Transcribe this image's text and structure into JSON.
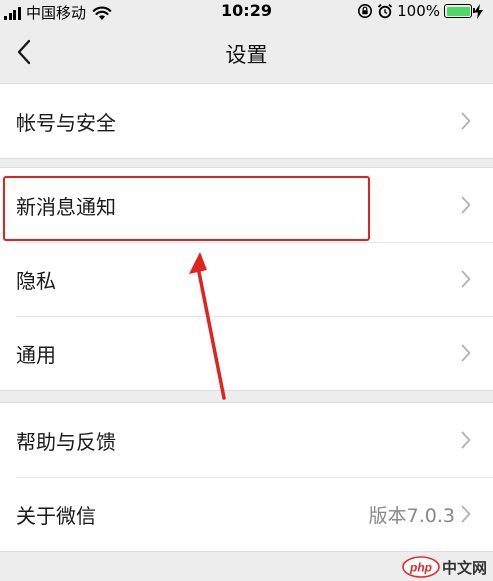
{
  "status_bar": {
    "carrier": "中国移动",
    "time": "10:29",
    "battery_percent": "100%",
    "battery_level": 1.0
  },
  "nav": {
    "title": "设置",
    "back_icon": "chevron-left-icon"
  },
  "groups": [
    {
      "items": [
        {
          "label": "帐号与安全"
        }
      ]
    },
    {
      "items": [
        {
          "label": "新消息通知"
        },
        {
          "label": "隐私"
        },
        {
          "label": "通用"
        }
      ]
    },
    {
      "items": [
        {
          "label": "帮助与反馈"
        },
        {
          "label": "关于微信",
          "value": "版本7.0.3"
        }
      ]
    }
  ],
  "annotation": {
    "highlighted_item": "新消息通知",
    "color": "#e0231f"
  },
  "watermark": {
    "logo": "php",
    "text": "中文网"
  },
  "colors": {
    "background": "#ededed",
    "row_background": "#ffffff",
    "battery_fill": "#4cd964",
    "secondary_text": "#888888"
  }
}
